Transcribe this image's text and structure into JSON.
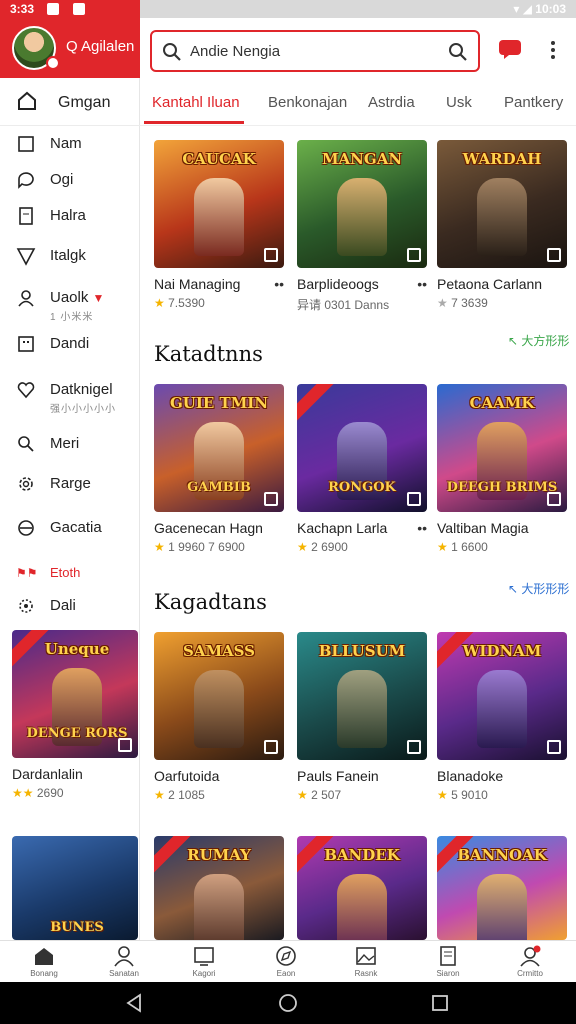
{
  "status_bar": {
    "time_left": "3:33",
    "time_right": "10:03"
  },
  "sidebar": {
    "user": "Q Agilalen",
    "home_label": "Gmgan",
    "items": [
      {
        "label": "Nam",
        "icon": "square-icon"
      },
      {
        "label": "Ogi",
        "icon": "chat-icon"
      },
      {
        "label": "Halra",
        "icon": "document-icon"
      },
      {
        "label": "Italgk",
        "icon": "triangle-icon"
      },
      {
        "label": "Uaolk",
        "icon": "person-icon",
        "sub": "1 小米米"
      },
      {
        "label": "Dandi",
        "icon": "grid-icon"
      },
      {
        "label": "Datknigel",
        "icon": "heart-icon",
        "sub": "强小小小小小"
      },
      {
        "label": "Meri",
        "icon": "search-icon"
      },
      {
        "label": "Rarge",
        "icon": "gear-icon"
      },
      {
        "label": "Gacatia",
        "icon": "minus-circle-icon"
      },
      {
        "label": "Etoth",
        "icon": "flag-icon"
      },
      {
        "label": "Dali",
        "icon": "settings-icon"
      }
    ],
    "side_card": {
      "name": "Dardanlalin",
      "rating": "2690",
      "title": "Uneque",
      "title2": "DENGE RORS"
    }
  },
  "search": {
    "placeholder": "Andie Nengia",
    "value": "Andie Nengia"
  },
  "tabs": [
    "Kantahl Iluan",
    "Benkonajan",
    "Astrdia",
    "Usk",
    "Pantkery"
  ],
  "row1": [
    {
      "title": "CAUCAK",
      "name": "Nai Managing",
      "rating": "7.5390",
      "rating_color": "orange",
      "sub": ""
    },
    {
      "title": "MANGAN",
      "name": "Barplideoogs",
      "rating": "0301 Danns",
      "rating_color": "gray",
      "sub": "异请"
    },
    {
      "title": "WARDAH",
      "name": "Petaona Carlann",
      "rating": "7 3639",
      "rating_color": "gray",
      "sub": ""
    }
  ],
  "section1": {
    "title": "Katadtnns",
    "link": "大方形形"
  },
  "row2": [
    {
      "title": "GUIE TMIN",
      "title2": "GAMBIB",
      "name": "Gacenecan Hagn",
      "rating": "1 9960 7 6900"
    },
    {
      "title": "",
      "title2": "RONGOK",
      "name": "Kachapn Larla",
      "rating": "2 6900"
    },
    {
      "title": "CAAMK",
      "title2": "DEEGH BRIMS",
      "name": "Valtiban Magia",
      "rating": "1 6600"
    }
  ],
  "section2": {
    "title": "Kagadtans",
    "link": "大形形形"
  },
  "row3": [
    {
      "title": "SAMASS",
      "name": "Oarfutoida",
      "rating": "2 1085"
    },
    {
      "title": "BLLUSUM",
      "name": "Pauls Fanein",
      "rating": "2 507"
    },
    {
      "title": "WIDNAM",
      "name": "Blanadoke",
      "rating": "5 9010"
    }
  ],
  "row4": [
    {
      "title": "BUNES"
    },
    {
      "title": "RUMAY"
    },
    {
      "title": "BANDEK"
    },
    {
      "title": "BANNOAK"
    }
  ],
  "bottom_nav": [
    {
      "label": "Bonang",
      "icon": "home-icon"
    },
    {
      "label": "Sanatan",
      "icon": "person-icon"
    },
    {
      "label": "Kagori",
      "icon": "monitor-icon"
    },
    {
      "label": "Eaon",
      "icon": "compass-icon"
    },
    {
      "label": "Rasnk",
      "icon": "image-icon"
    },
    {
      "label": "Siaron",
      "icon": "book-icon"
    },
    {
      "label": "Crmitto",
      "icon": "user-badge-icon"
    }
  ],
  "colors": {
    "accent": "#e0262b",
    "star": "#f5b400",
    "link_green": "#3aa64a",
    "link_blue": "#2c6fd1"
  }
}
